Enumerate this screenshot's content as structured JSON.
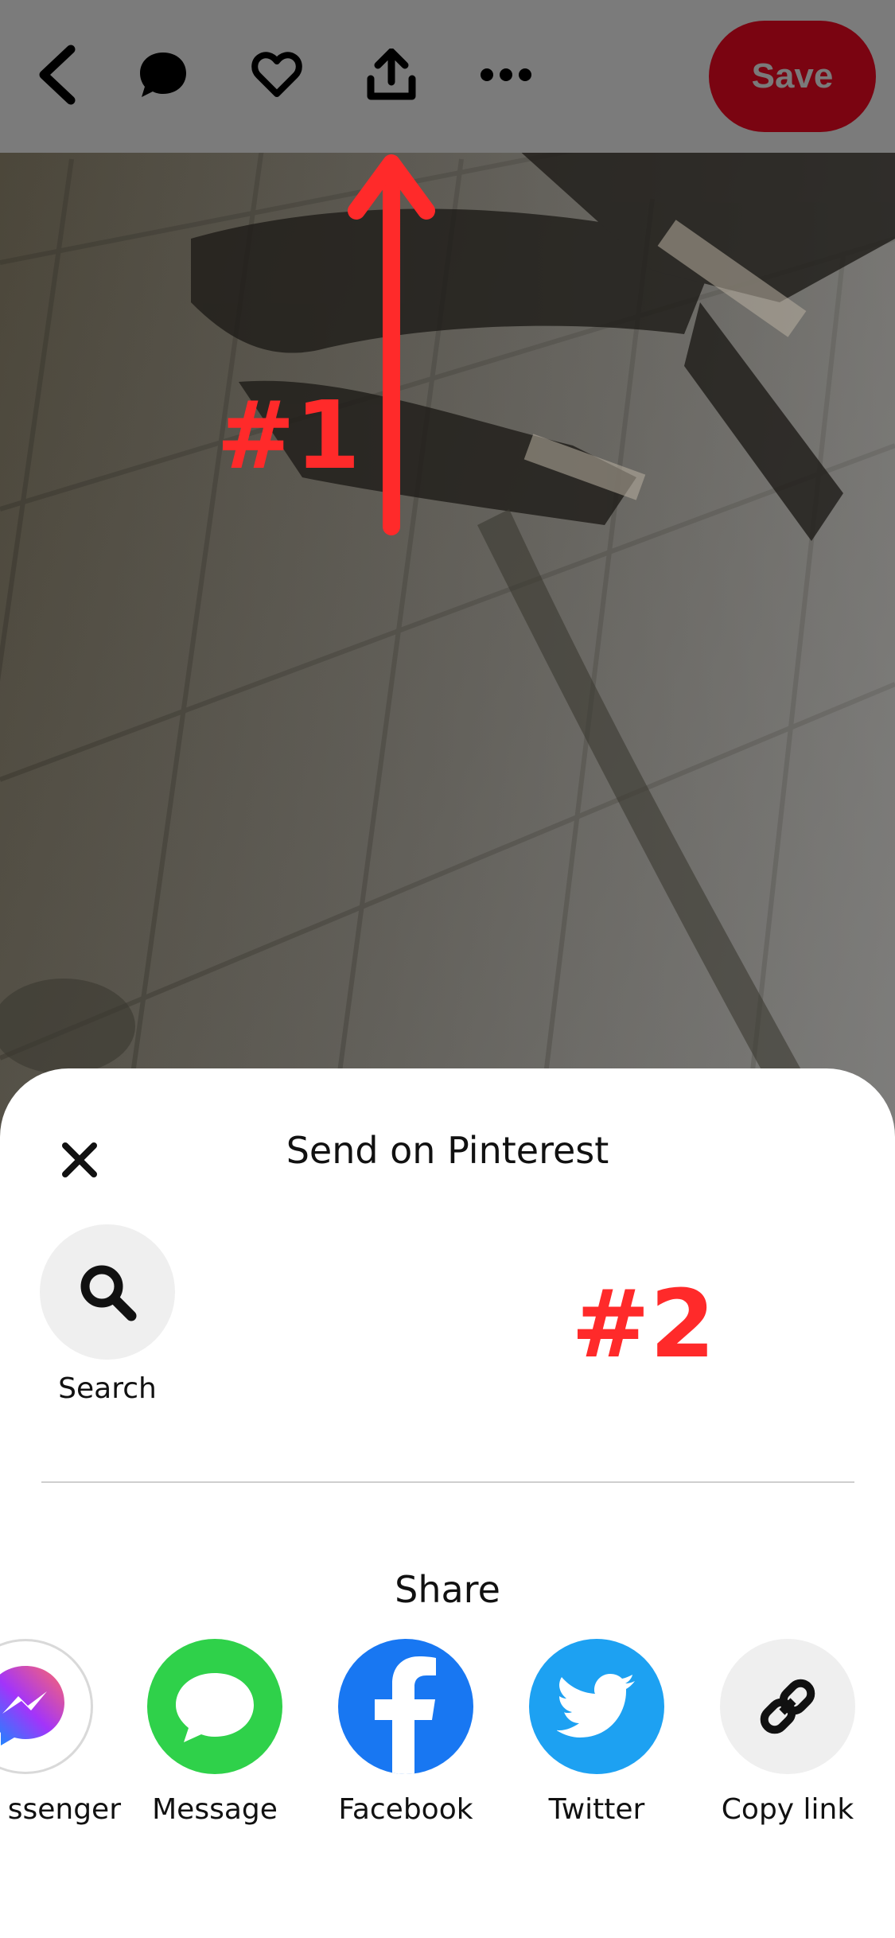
{
  "topbar": {
    "save_label": "Save",
    "icons": [
      "back-icon",
      "comment-icon",
      "heart-icon",
      "share-icon",
      "more-icon"
    ]
  },
  "annotations": {
    "first": "#1",
    "second": "#2"
  },
  "sheet": {
    "title": "Send on Pinterest",
    "search_label": "Search",
    "share_title": "Share",
    "apps": [
      {
        "label": "ssenger",
        "icon": "messenger-icon"
      },
      {
        "label": "Message",
        "icon": "message-icon"
      },
      {
        "label": "Facebook",
        "icon": "facebook-icon"
      },
      {
        "label": "Twitter",
        "icon": "twitter-icon"
      },
      {
        "label": "Copy link",
        "icon": "link-icon"
      }
    ]
  },
  "colors": {
    "save_bg": "#7a0411",
    "annotation": "#ff2a2a",
    "message_green": "#2fd14a",
    "facebook_blue": "#1877f2",
    "twitter_blue": "#1da1f2"
  }
}
